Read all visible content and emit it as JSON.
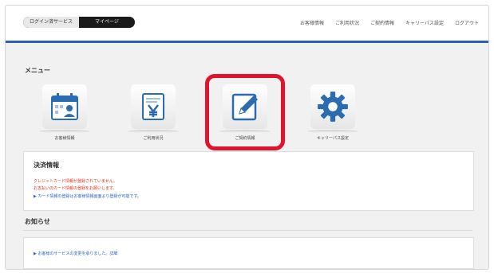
{
  "header": {
    "logo_left": "ログイン済サービス",
    "logo_right": "マイページ",
    "nav": [
      "お客様情報",
      "ご利用状況",
      "ご契約情報",
      "キャリーパス設定",
      "ログアウト"
    ]
  },
  "menu": {
    "title": "メニュー",
    "tiles": [
      {
        "label": "お客様情報",
        "icon": "calendar-user-icon"
      },
      {
        "label": "ご利用状況",
        "icon": "invoice-yen-icon"
      },
      {
        "label": "ご契約情報",
        "icon": "pencil-edit-icon"
      },
      {
        "label": "キャリーパス設定",
        "icon": "gear-icon"
      }
    ]
  },
  "settlement": {
    "title": "決済情報",
    "lines": [
      "クレジットカード情報が登録されていません。",
      "お支払いのカード情報の登録をお願いします。",
      "▶ カード情報の登録はお客様情報画面より登録が可能です。"
    ]
  },
  "notice": {
    "title": "お知らせ",
    "line": "▶ お客様のサービスの変更を承りました。詳細"
  },
  "colors": {
    "accent": "#2f5fb5",
    "highlight": "#e2142d",
    "warning": "#e3311b",
    "link": "#2f64c9"
  }
}
